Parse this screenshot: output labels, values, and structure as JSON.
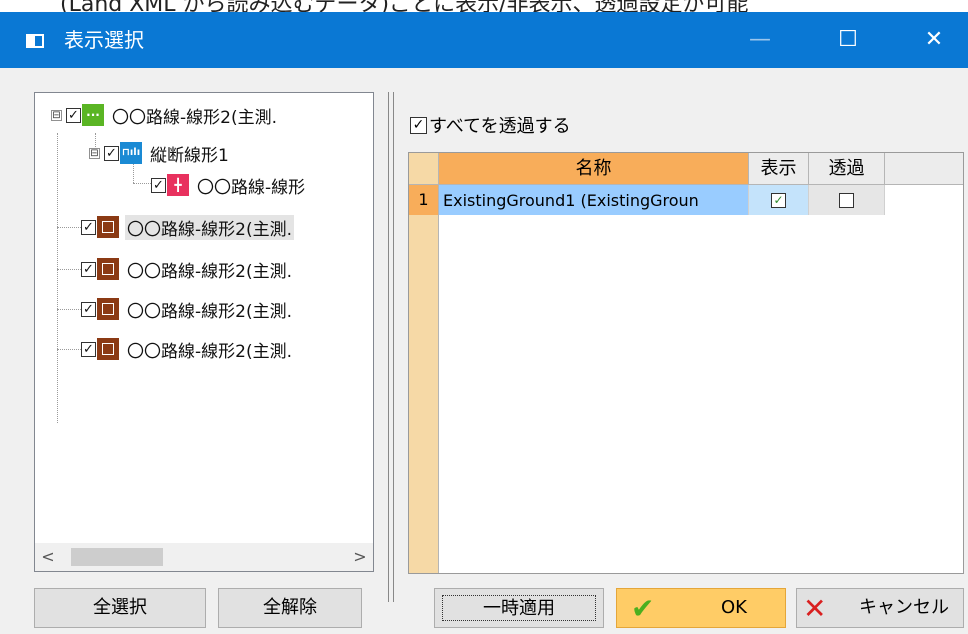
{
  "window": {
    "title": "表示選択",
    "min_glyph": "—",
    "max_glyph": "☐",
    "close_glyph": "✕"
  },
  "top_strip_text": "(Land XML から読み込むデータ)ごとに表示/非表示、透過設定が可能",
  "tree": {
    "items": [
      {
        "label": "〇〇路線-線形2(主測.",
        "icon": "layout-icon",
        "expander": "⊟"
      },
      {
        "label": "縦断線形1",
        "icon": "profile-icon",
        "expander": "⊟",
        "icon_text": "⊓ılı"
      },
      {
        "label": "〇〇路線-線形",
        "icon": "alignment-icon",
        "icon_text": "╋"
      },
      {
        "label": "〇〇路線-線形2(主測.",
        "icon": "surface-icon"
      },
      {
        "label": "〇〇路線-線形2(主測.",
        "icon": "surface-icon"
      },
      {
        "label": "〇〇路線-線形2(主測.",
        "icon": "surface-icon"
      },
      {
        "label": "〇〇路線-線形2(主測.",
        "icon": "surface-icon"
      }
    ],
    "check_glyph": "✓",
    "green_icon_text": "···",
    "scroll_left": "<",
    "scroll_right": ">"
  },
  "right": {
    "all_transparent_label": "すべてを透過する",
    "grid": {
      "columns": [
        "名称",
        "表示",
        "透過"
      ],
      "rows": [
        {
          "num": "1",
          "name": "ExistingGround1 (ExistingGroun",
          "show": "✓",
          "trans": ""
        }
      ]
    }
  },
  "buttons": {
    "select_all": "全選択",
    "deselect_all": "全解除",
    "temp_apply": "一時適用",
    "ok": "OK",
    "ok_icon": "✔",
    "cancel": "キャンセル",
    "cancel_icon": "✕"
  },
  "colors": {
    "titlebar": "#0a78d4",
    "grid_header_active": "#f8ad5a",
    "ok_button": "#ffcc66",
    "selected_cell": "#99ccff"
  }
}
